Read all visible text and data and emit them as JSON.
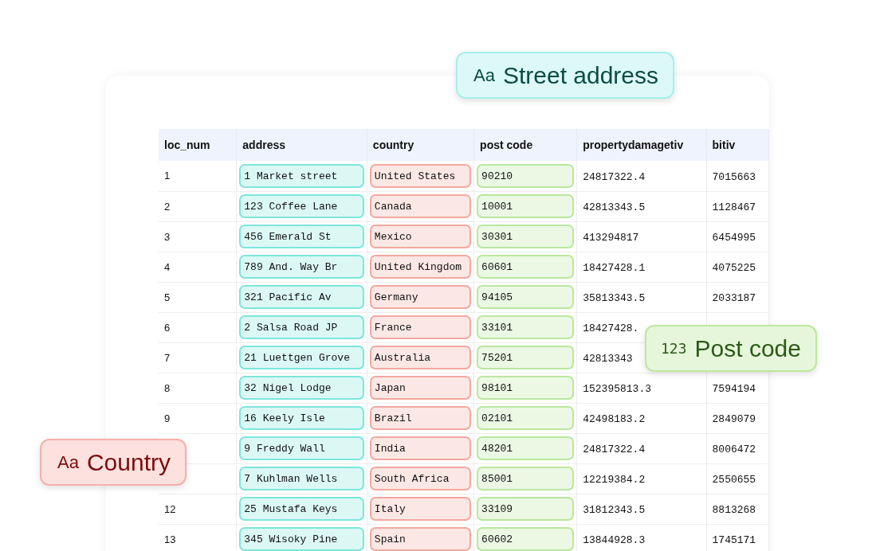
{
  "table": {
    "columns": [
      {
        "label": "loc_num",
        "kind": "sans"
      },
      {
        "label": "address",
        "kind": "pill",
        "color": "#7de6da"
      },
      {
        "label": "country",
        "kind": "pill",
        "color": "#f2a99f"
      },
      {
        "label": "post code",
        "kind": "pill",
        "color": "#b9e79f"
      },
      {
        "label": "propertydamagetiv",
        "kind": "mono"
      },
      {
        "label": "bitiv",
        "kind": "mono"
      }
    ],
    "rows": [
      {
        "cells": [
          "1",
          "1 Market street",
          "United States",
          "90210",
          "24817322.4",
          "7015663"
        ]
      },
      {
        "cells": [
          "2",
          "123 Coffee Lane",
          "Canada",
          "10001",
          "42813343.5",
          "1128467"
        ]
      },
      {
        "cells": [
          "3",
          "456 Emerald St",
          "Mexico",
          "30301",
          "413294817",
          "6454995"
        ]
      },
      {
        "cells": [
          "4",
          "789 And. Way Br",
          "United Kingdom",
          "60601",
          "18427428.1",
          "4075225"
        ]
      },
      {
        "cells": [
          "5",
          "321 Pacific Av",
          "Germany",
          "94105",
          "35813343.5",
          "2033187"
        ]
      },
      {
        "cells": [
          "6",
          "2 Salsa Road JP",
          "France",
          "33101",
          "18427428.",
          null
        ]
      },
      {
        "cells": [
          "7",
          "21 Luettgen Grove",
          "Australia",
          "75201",
          "42813343",
          null
        ]
      },
      {
        "cells": [
          "8",
          "32 Nigel Lodge",
          "Japan",
          "98101",
          "152395813.3",
          "7594194"
        ]
      },
      {
        "cells": [
          "9",
          "16 Keely Isle",
          "Brazil",
          "02101",
          "42498183.2",
          "2849079"
        ]
      },
      {
        "cells": [
          null,
          "9 Freddy Wall",
          "India",
          "48201",
          "24817322.4",
          "8006472"
        ]
      },
      {
        "cells": [
          null,
          "7 Kuhlman Wells",
          "South Africa",
          "85001",
          "12219384.2",
          "2550655"
        ]
      },
      {
        "cells": [
          "12",
          "25 Mustafa Keys",
          "Italy",
          "33109",
          "31812343.5",
          "8813268"
        ]
      },
      {
        "cells": [
          "13",
          "345 Wisoky Pine",
          "Spain",
          "60602",
          "13844928.3",
          "1745171"
        ]
      }
    ]
  },
  "badges": [
    {
      "icon": "Aa",
      "label": "Street address",
      "color": "#a5efea"
    },
    {
      "icon": "123",
      "label": "Post code",
      "color": "#bde8a0"
    },
    {
      "icon": "Aa",
      "label": "Country",
      "color": "#f6b0a8"
    }
  ]
}
